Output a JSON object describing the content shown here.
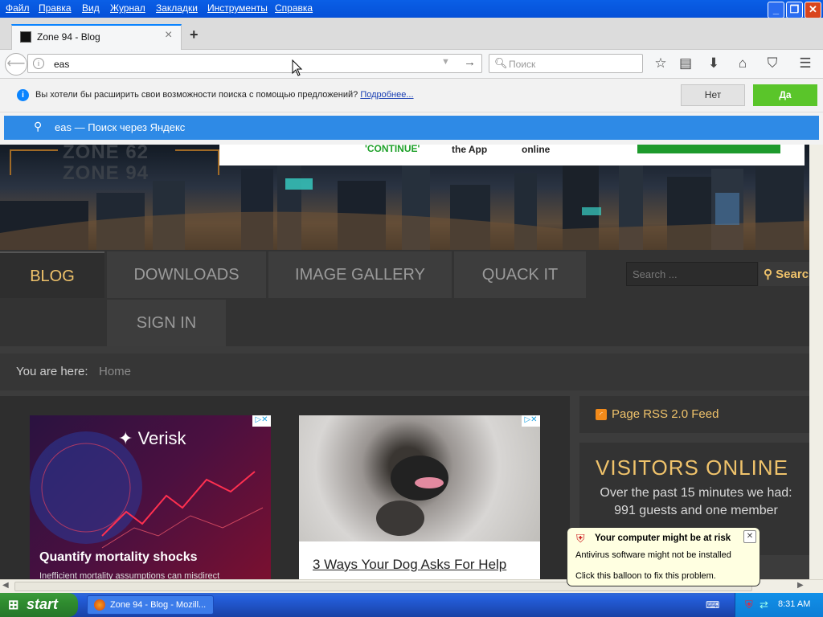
{
  "menu": [
    "Файл",
    "Правка",
    "Вид",
    "Журнал",
    "Закладки",
    "Инструменты",
    "Справка"
  ],
  "window_buttons": {
    "minimize": "_",
    "maximize": "❐",
    "close": "✕"
  },
  "tab": {
    "title": "Zone 94 - Blog",
    "close": "×",
    "new_tab": "+"
  },
  "urlbar": {
    "value": "eas"
  },
  "search": {
    "placeholder": "Поиск"
  },
  "notification": {
    "text": "Вы хотели бы расширить свои возможности поиска с помощью предложений?",
    "link": "Подробнее...",
    "no": "Нет",
    "yes": "Да"
  },
  "suggestion": {
    "query": "eas",
    "sep": " — ",
    "engine_text": "Поиск через Яндекс"
  },
  "site": {
    "banner_logo1": "ZONE 62",
    "banner_logo2": "ZONE 94",
    "ad_strip": [
      "'CONTINUE'",
      "the App",
      "online"
    ],
    "nav": [
      "BLOG",
      "DOWNLOADS",
      "IMAGE GALLERY",
      "QUACK IT",
      "SIGN IN"
    ],
    "search_placeholder": "Search ...",
    "search_button": "Search",
    "breadcrumb_label": "You are here:",
    "breadcrumb_home": "Home",
    "ad1_brand": "Verisk",
    "ad1_headline": "Quantify mortality shocks",
    "ad1_sub": "Inefficient mortality assumptions can misdirect",
    "ad2_headline": "3 Ways Your Dog Asks For Help",
    "rss": "Page RSS 2.0 Feed",
    "visitors_title": "VISITORS ONLINE",
    "visitors_text": "Over the past 15 minutes we had: 991 guests and one member"
  },
  "balloon": {
    "title": "Your computer might be at risk",
    "line1": "Antivirus software might not be installed",
    "line2": "Click this balloon to fix this problem.",
    "close": "✕"
  },
  "taskbar": {
    "start": "start",
    "task": "Zone 94 - Blog - Mozill...",
    "time": "8:31 AM"
  },
  "colors": {
    "accent": "#0a84ff",
    "suggest": "#2e8ae6",
    "yes_button": "#5ac52a",
    "link_gold": "#f0c36b",
    "nav_active_bg": "#2e2e2e"
  }
}
